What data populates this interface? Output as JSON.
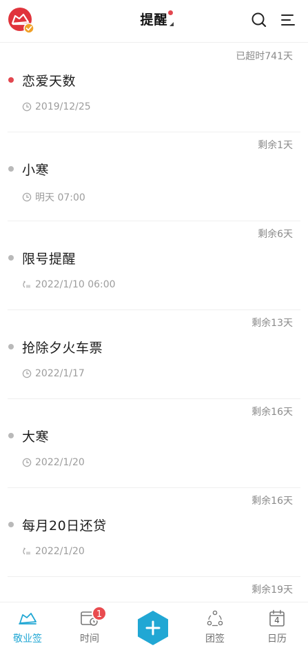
{
  "header": {
    "title": "提醒",
    "icons": {
      "logo": "cloud-logo-icon",
      "search": "search-icon",
      "menu": "menu-icon"
    }
  },
  "reminders": [
    {
      "status": "已超时741天",
      "name": "恋爱天数",
      "meta": "2019/12/25",
      "icon": "clock-icon",
      "dot": "red"
    },
    {
      "status": "剩余1天",
      "name": "小寒",
      "meta": "明天 07:00",
      "icon": "clock-icon",
      "dot": "gray"
    },
    {
      "status": "剩余6天",
      "name": "限号提醒",
      "meta": "2022/1/10 06:00",
      "icon": "repeat-icon",
      "dot": "gray"
    },
    {
      "status": "剩余13天",
      "name": "抢除夕火车票",
      "meta": "2022/1/17",
      "icon": "clock-icon",
      "dot": "gray"
    },
    {
      "status": "剩余16天",
      "name": "大寒",
      "meta": "2022/1/20",
      "icon": "clock-icon",
      "dot": "gray"
    },
    {
      "status": "剩余16天",
      "name": "每月20日还贷",
      "meta": "2022/1/20",
      "icon": "repeat-icon",
      "dot": "gray"
    },
    {
      "status": "剩余19天"
    }
  ],
  "nav": {
    "tabs": [
      {
        "label": "敬业签",
        "icon": "cloud-tab-icon",
        "active": true
      },
      {
        "label": "时间",
        "icon": "calendar-clock-icon",
        "badge": "1"
      },
      {
        "label": "",
        "icon": "add-icon"
      },
      {
        "label": "团签",
        "icon": "team-icon"
      },
      {
        "label": "日历",
        "icon": "calendar-icon",
        "date": "4"
      }
    ]
  },
  "colors": {
    "accent": "#21a7d4",
    "alert": "#e2474f",
    "status_text": "#8a8a8a",
    "meta_text": "#9c9c9c"
  }
}
